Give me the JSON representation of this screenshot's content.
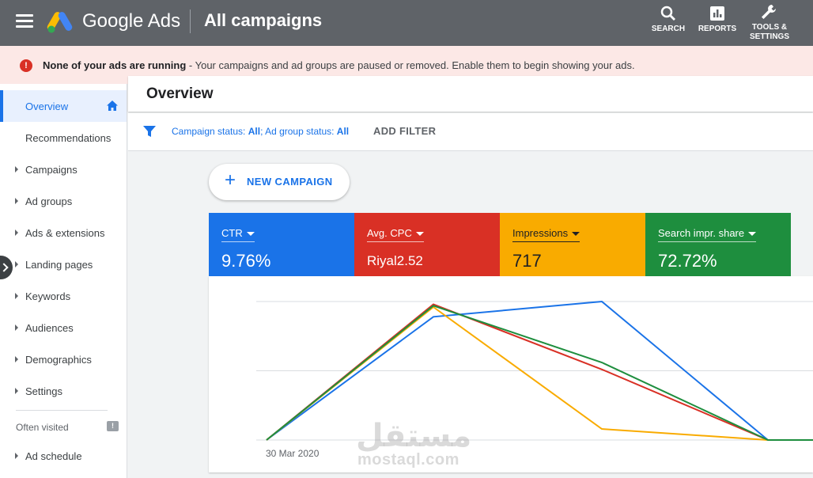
{
  "header": {
    "brand": "Google Ads",
    "page_title": "All campaigns",
    "tools": {
      "search": "SEARCH",
      "reports": "REPORTS",
      "settings_line1": "TOOLS &",
      "settings_line2": "SETTINGS"
    }
  },
  "alert": {
    "bold": "None of your ads are running",
    "text": " - Your campaigns and ad groups are paused or removed. Enable them to begin showing your ads.",
    "icon": "!"
  },
  "sidebar": {
    "items": [
      {
        "label": "Overview"
      },
      {
        "label": "Recommendations"
      },
      {
        "label": "Campaigns"
      },
      {
        "label": "Ad groups"
      },
      {
        "label": "Ads & extensions"
      },
      {
        "label": "Landing pages"
      },
      {
        "label": "Keywords"
      },
      {
        "label": "Audiences"
      },
      {
        "label": "Demographics"
      },
      {
        "label": "Settings"
      }
    ],
    "often_visited": "Often visited",
    "often_items": [
      {
        "label": "Ad schedule"
      }
    ]
  },
  "overview": {
    "title": "Overview",
    "filter_prefix1": "Campaign status: ",
    "filter_value1": "All",
    "filter_prefix2": "; Ad group status: ",
    "filter_value2": "All",
    "add_filter": "ADD FILTER",
    "new_campaign": "NEW CAMPAIGN",
    "plus": "+"
  },
  "scorecards": [
    {
      "metric": "CTR",
      "value": "9.76%",
      "color": "#1a73e8"
    },
    {
      "metric": "Avg. CPC",
      "value": "Riyal2.52",
      "color": "#d93025"
    },
    {
      "metric": "Impressions",
      "value": "717",
      "color": "#f9ab00"
    },
    {
      "metric": "Search impr. share",
      "value": "72.72%",
      "color": "#1e8e3e"
    }
  ],
  "chart": {
    "x_label": "30 Mar 2020"
  },
  "chart_data": {
    "type": "line",
    "x": [
      1,
      2,
      3,
      4,
      5
    ],
    "series": [
      {
        "color": "#1a73e8",
        "values": [
          0,
          89,
          100,
          0,
          0
        ]
      },
      {
        "color": "#d93025",
        "values": [
          0,
          98,
          51,
          0,
          0
        ]
      },
      {
        "color": "#f9ab00",
        "values": [
          0,
          96,
          8,
          0,
          0
        ]
      },
      {
        "color": "#1e8e3e",
        "values": [
          0,
          97,
          56,
          0,
          0
        ]
      }
    ],
    "ylim": [
      0,
      100
    ],
    "grid": true
  },
  "watermark": {
    "arabic": "مستقل",
    "latin": "mostaql.com"
  }
}
